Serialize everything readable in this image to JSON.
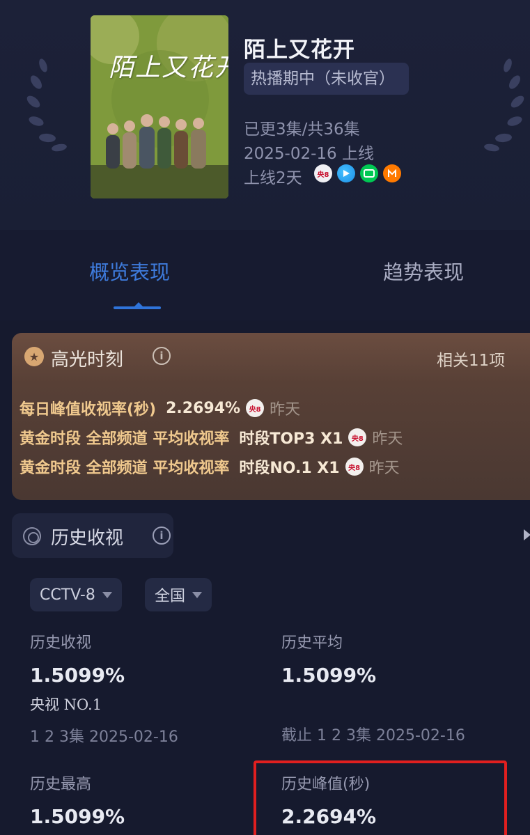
{
  "header": {
    "poster_title": "陌上又花开",
    "title": "陌上又花开",
    "status": "热播期中（未收官）",
    "episodes": "已更3集/共36集",
    "release_date": "2025-02-16 上线",
    "online_days": "上线2天",
    "platforms": [
      {
        "name": "cctv8-icon",
        "label": "央8",
        "color": "#c8102e"
      },
      {
        "name": "tencent-video-icon",
        "label": "",
        "color": "#1c8fe6"
      },
      {
        "name": "iqiyi-icon",
        "label": "",
        "color": "#00c853"
      },
      {
        "name": "mgtv-icon",
        "label": "",
        "color": "#ff7a00"
      }
    ]
  },
  "tabs": {
    "overview": "概览表现",
    "trend": "趋势表现"
  },
  "highlights": {
    "title": "高光时刻",
    "info_glyph": "i",
    "related": "相关11项",
    "rows": [
      {
        "label": "每日峰值收视率(秒)",
        "value": "2.2694%",
        "channel": "央8",
        "when": "昨天"
      },
      {
        "label": "黄金时段 全部频道 平均收视率",
        "value": "时段TOP3 X1",
        "channel": "央8",
        "when": "昨天"
      },
      {
        "label": "黄金时段 全部频道 平均收视率",
        "value": "时段NO.1 X1",
        "channel": "央8",
        "when": "昨天"
      }
    ]
  },
  "history": {
    "title": "历史收视",
    "info_glyph": "i",
    "filters": {
      "channel": "CCTV-8",
      "region": "全国"
    },
    "stats": [
      {
        "label": "历史收视",
        "value": "1.5099%",
        "sub": "央视 NO.1",
        "foot": "1 2 3集 2025-02-16"
      },
      {
        "label": "历史平均",
        "value": "1.5099%",
        "foot": "截止 1 2 3集 2025-02-16"
      },
      {
        "label": "历史最高",
        "value": "1.5099%"
      },
      {
        "label": "历史峰值(秒)",
        "value": "2.2694%"
      }
    ]
  },
  "colors": {
    "accent": "#2f74da",
    "highlight_gold": "#f0c98e",
    "annotation_red": "#e01f1f"
  }
}
